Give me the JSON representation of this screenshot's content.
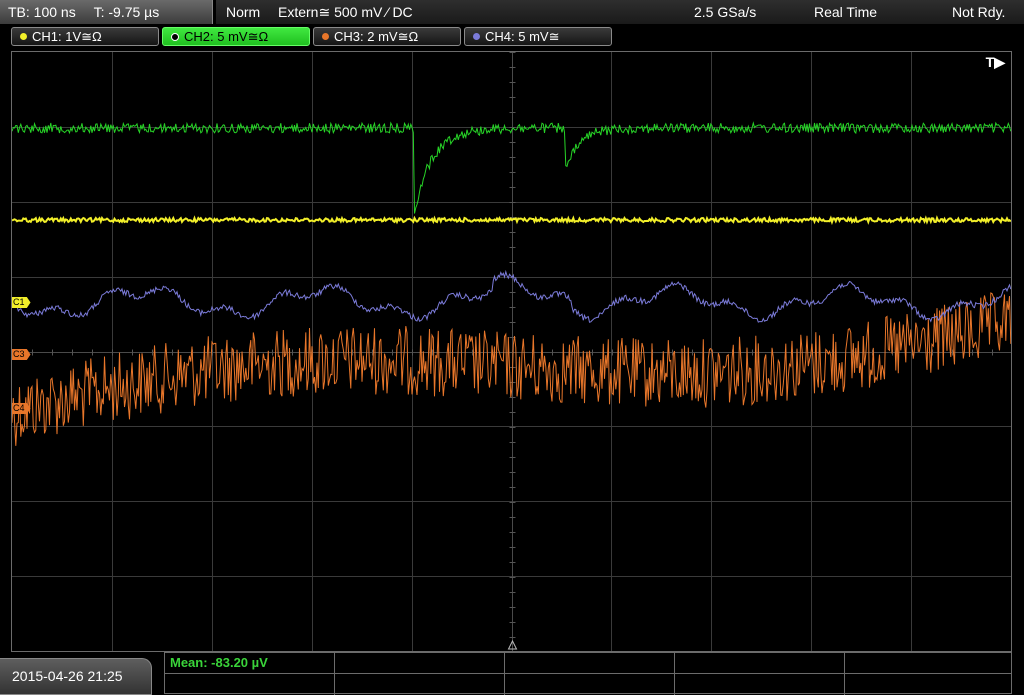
{
  "topbar": {
    "timebase": "TB: 100 ns",
    "trigger_pos": "T: -9.75 µs",
    "mode": "Norm",
    "trigger_source": "Extern≅ 500 mV ⁄ DC",
    "sample_rate": "2.5 GSa/s",
    "acq_mode": "Real Time",
    "status": "Not Rdy."
  },
  "channels": [
    {
      "label": "CH1: 1V≅Ω",
      "color": "#f2ef2a"
    },
    {
      "label": "CH2: 5 mV≅Ω",
      "color": "#27d427"
    },
    {
      "label": "CH3: 2 mV≅Ω",
      "color": "#e8762a"
    },
    {
      "label": "CH4: 5 mV≅",
      "color": "#7b7bd9"
    }
  ],
  "screen": {
    "trigger_indicator": "T▶",
    "markers": {
      "c1": "C1",
      "c3": "C3",
      "c4": "C4"
    }
  },
  "bottombar": {
    "datetime": "2015-04-26 21:25",
    "measurement": "Mean: -83.20 µV"
  }
}
